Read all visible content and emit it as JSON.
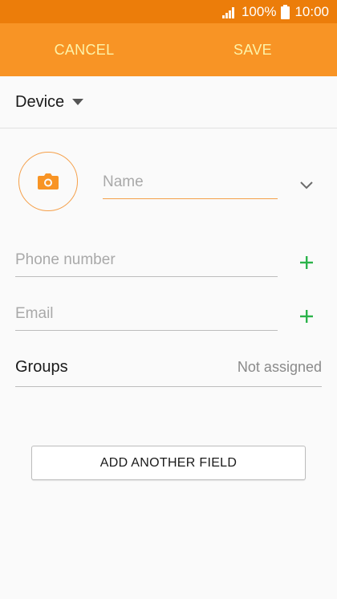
{
  "status_bar": {
    "battery_percent": "100%",
    "time": "10:00",
    "icons": [
      "signal-icon",
      "battery-icon"
    ]
  },
  "action_bar": {
    "cancel_label": "CANCEL",
    "save_label": "SAVE"
  },
  "account": {
    "label": "Device"
  },
  "form": {
    "name_placeholder": "Name",
    "phone_placeholder": "Phone number",
    "email_placeholder": "Email",
    "groups_label": "Groups",
    "groups_value": "Not assigned",
    "add_field_label": "ADD ANOTHER FIELD"
  },
  "colors": {
    "status_bar": "#ec7d0a",
    "action_bar": "#f89425",
    "action_text": "#fdf3a8",
    "accent": "#f5a04a",
    "plus_green": "#2bb34a"
  }
}
